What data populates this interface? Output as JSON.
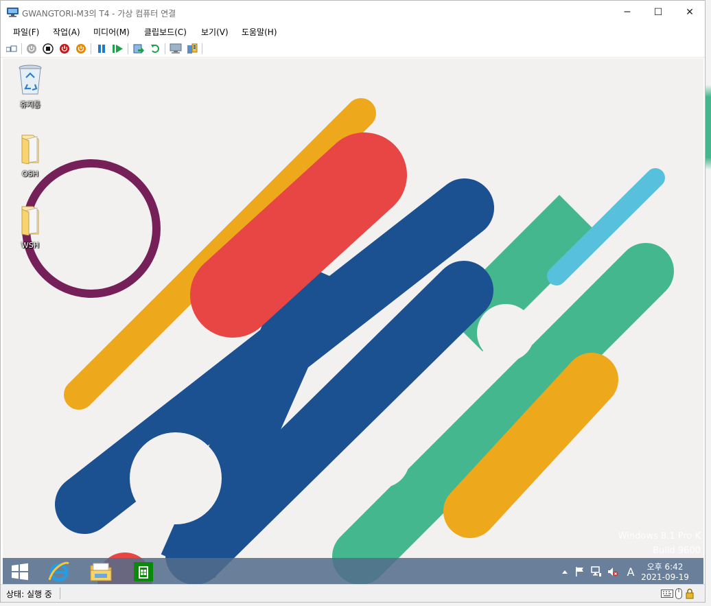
{
  "window": {
    "title": "GWANGTORI-M3의 T4 - 가상 컴퓨터 연결",
    "controls": {
      "minimize": "─",
      "maximize": "☐",
      "close": "✕"
    }
  },
  "menu": [
    {
      "label": "파일(F)"
    },
    {
      "label": "작업(A)"
    },
    {
      "label": "미디어(M)"
    },
    {
      "label": "클립보드(C)"
    },
    {
      "label": "보기(V)"
    },
    {
      "label": "도움말(H)"
    }
  ],
  "toolbar_icons": [
    "ctrl-alt-del-icon",
    "start-icon",
    "turn-off-icon",
    "shut-down-icon",
    "save-icon",
    "pause-icon",
    "resume-icon",
    "checkpoint-icon",
    "revert-icon",
    "enhanced-session-icon",
    "share-icon"
  ],
  "desktop": {
    "icons": [
      {
        "label": "휴지통",
        "icon": "recycle-bin-icon"
      },
      {
        "label": "OSH",
        "icon": "folder-icon"
      },
      {
        "label": "WSH",
        "icon": "folder-icon"
      }
    ],
    "watermark": {
      "line1": "Windows 8.1 Pro K",
      "line2": "Build 9600"
    }
  },
  "taskbar": {
    "items": [
      "start-button-icon",
      "internet-explorer-icon",
      "file-explorer-icon",
      "store-icon"
    ],
    "tray": {
      "ime": "A",
      "time": "오후 6:42",
      "date": "2021-09-19"
    }
  },
  "status": {
    "text": "상태: 실행 중"
  },
  "colors": {
    "wall_bg": "#f2f1ef",
    "yellow": "#eda81c",
    "red": "#e84545",
    "navy": "#1b5191",
    "green": "#45b78e",
    "cyan": "#57c1dd",
    "purple": "#76205a"
  }
}
